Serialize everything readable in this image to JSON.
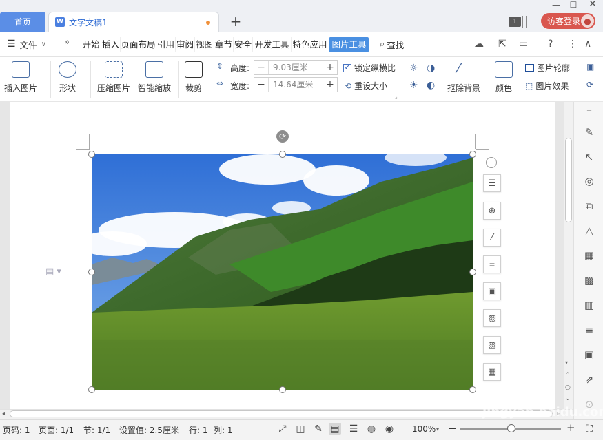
{
  "titlebar": {
    "home_tab": "首页",
    "doc_tab": "文字文稿1",
    "doc_icon": "W",
    "new_tab": "+",
    "badge": "1",
    "guest_login": "访客登录"
  },
  "menu": {
    "file": "文件",
    "tabs": [
      "开始",
      "插入",
      "页面布局",
      "引用",
      "审阅",
      "视图",
      "章节",
      "安全",
      "开发工具",
      "特色应用",
      "图片工具"
    ],
    "active_tab": "图片工具",
    "search": "查找"
  },
  "ribbon": {
    "insert_picture": "插入图片",
    "shape": "形状",
    "compress_picture": "压缩图片",
    "smart_zoom": "智能缩放",
    "crop": "裁剪",
    "height_label": "高度:",
    "height_value": "9.03厘米",
    "width_label": "宽度:",
    "width_value": "14.64厘米",
    "lock_ratio": "锁定纵横比",
    "reset_size": "重设大小",
    "remove_background": "抠除背景",
    "color": "颜色",
    "picture_outline": "图片轮廓",
    "picture_effect": "图片效果"
  },
  "statusbar": {
    "page_num": "页码: 1",
    "pages": "页面: 1/1",
    "section": "节: 1/1",
    "setting": "设置值: 2.5厘米",
    "row": "行: 1",
    "col": "列: 1",
    "zoom": "100%"
  },
  "watermark": "Bai 经验 jingyan.baidu.com",
  "colors": {
    "accent": "#4a90e2",
    "home_tab": "#5b8ee6",
    "login": "#d9574f"
  }
}
